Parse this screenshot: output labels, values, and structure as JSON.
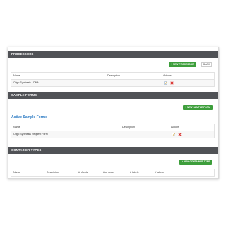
{
  "processors": {
    "header": "PROCESSORS",
    "new_button": "+ NEW PROCESSOR",
    "back_button": "BACK",
    "columns": [
      "Name",
      "Description",
      "Actions"
    ],
    "rows": [
      {
        "name": "Oligo Synthesis - DNA",
        "description": ""
      }
    ]
  },
  "sample_forms": {
    "header": "SAMPLE FORMS",
    "new_button": "+ NEW SAMPLE FORM",
    "subtitle": "Active Sample Forms",
    "columns": [
      "Name",
      "Description",
      "Actions"
    ],
    "rows": [
      {
        "name": "Oligo Synthesis Request Form",
        "description": ""
      }
    ]
  },
  "container_types": {
    "header": "CONTAINER TYPES",
    "new_button": "+ NEW CONTAINER TYPE",
    "columns": [
      "Name",
      "Description",
      "# of cols",
      "# of rows",
      "# labels",
      "Y labels"
    ]
  },
  "colors": {
    "header_bg": "#505256",
    "button_green": "#3d9e3b",
    "link_blue": "#2e7cc4",
    "delete_red": "#d9302c"
  }
}
